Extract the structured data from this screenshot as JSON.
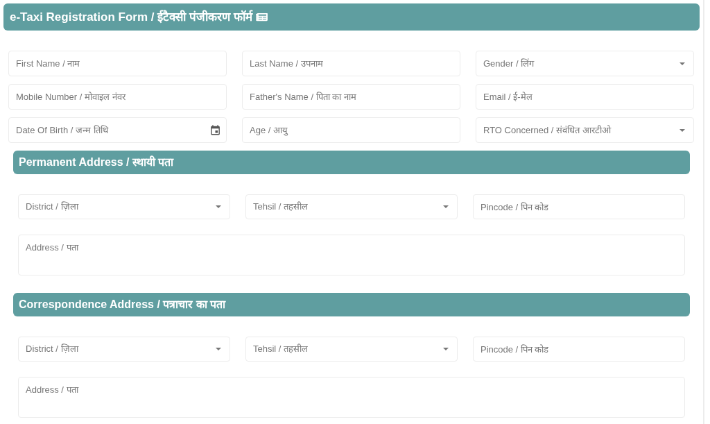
{
  "form": {
    "title": "e-Taxi Registration Form / ईटैक्सी पंजीकरण फॉर्म",
    "fields": [
      {
        "kind": "text",
        "placeholder": "First Name / नाम"
      },
      {
        "kind": "text",
        "placeholder": "Last Name / उपनाम"
      },
      {
        "kind": "select",
        "placeholder": "Gender / लिंग"
      },
      {
        "kind": "text",
        "placeholder": "Mobile Number / मोवाइल नंवर"
      },
      {
        "kind": "text",
        "placeholder": "Father's Name / पिता का नाम"
      },
      {
        "kind": "text",
        "placeholder": "Email / ई-मेल"
      },
      {
        "kind": "date",
        "placeholder": "Date Of Birth / जन्म तिथि"
      },
      {
        "kind": "text",
        "placeholder": "Age / आयु"
      },
      {
        "kind": "select",
        "placeholder": "RTO Concerned / संवंधित आरटीओ"
      }
    ]
  },
  "sections": [
    {
      "title": "Permanent Address / स्थायी पता",
      "fields": [
        {
          "kind": "select",
          "placeholder": "District / ज़िला"
        },
        {
          "kind": "select",
          "placeholder": "Tehsil / तहसील"
        },
        {
          "kind": "text",
          "placeholder": "Pincode / पिन कोड"
        }
      ],
      "address": {
        "placeholder": "Address / पता"
      }
    },
    {
      "title": "Correspondence Address / पत्राचार का पता",
      "fields": [
        {
          "kind": "select",
          "placeholder": "District / ज़िला"
        },
        {
          "kind": "select",
          "placeholder": "Tehsil / तहसील"
        },
        {
          "kind": "text",
          "placeholder": "Pincode / पिन कोड"
        }
      ],
      "address": {
        "placeholder": "Address / पता"
      }
    }
  ]
}
